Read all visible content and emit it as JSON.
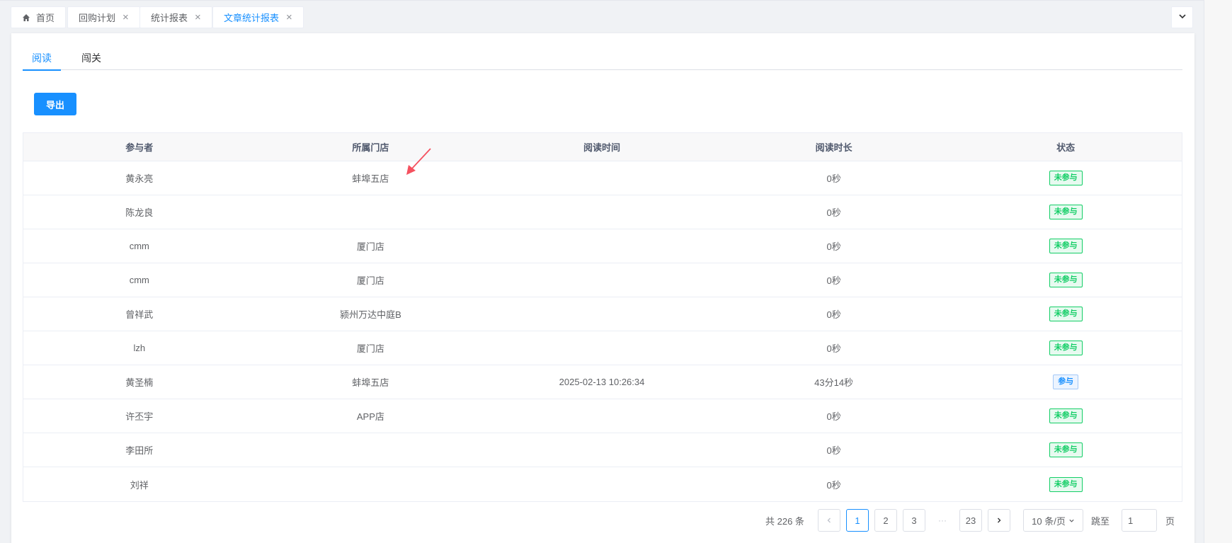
{
  "tabs": [
    {
      "label": "首页",
      "closable": false,
      "active": false
    },
    {
      "label": "回购计划",
      "closable": true,
      "active": false
    },
    {
      "label": "统计报表",
      "closable": true,
      "active": false
    },
    {
      "label": "文章统计报表",
      "closable": true,
      "active": true
    }
  ],
  "subtabs": [
    "阅读",
    "闯关"
  ],
  "export_label": "导出",
  "table": {
    "headers": [
      "参与者",
      "所属门店",
      "阅读时间",
      "阅读时长",
      "状态"
    ],
    "rows": [
      {
        "name": "黄永亮",
        "store": "蚌埠五店",
        "time": "",
        "duration": "0秒",
        "status": "未参与"
      },
      {
        "name": "陈龙良",
        "store": "",
        "time": "",
        "duration": "0秒",
        "status": "未参与"
      },
      {
        "name": "cmm",
        "store": "厦门店",
        "time": "",
        "duration": "0秒",
        "status": "未参与"
      },
      {
        "name": "cmm",
        "store": "厦门店",
        "time": "",
        "duration": "0秒",
        "status": "未参与"
      },
      {
        "name": "曾祥武",
        "store": "颍州万达中庭B",
        "time": "",
        "duration": "0秒",
        "status": "未参与"
      },
      {
        "name": "lzh",
        "store": "厦门店",
        "time": "",
        "duration": "0秒",
        "status": "未参与"
      },
      {
        "name": "黄圣楠",
        "store": "蚌埠五店",
        "time": "2025-02-13 10:26:34",
        "duration": "43分14秒",
        "status": "参与"
      },
      {
        "name": "许丕宇",
        "store": "APP店",
        "time": "",
        "duration": "0秒",
        "status": "未参与"
      },
      {
        "name": "李田所",
        "store": "",
        "time": "",
        "duration": "0秒",
        "status": "未参与"
      },
      {
        "name": "刘祥",
        "store": "",
        "time": "",
        "duration": "0秒",
        "status": "未参与"
      }
    ]
  },
  "pagination": {
    "total": "共 226 条",
    "pages": [
      "1",
      "2",
      "3"
    ],
    "dots": "···",
    "last": "23",
    "current": "1",
    "page_size": "10 条/页",
    "jump_label": "跳至",
    "jump_value": "1",
    "page_suffix": "页"
  },
  "colors": {
    "accent": "#1890ff",
    "not_joined": "#13ce66",
    "annotation": "#f5515f"
  }
}
